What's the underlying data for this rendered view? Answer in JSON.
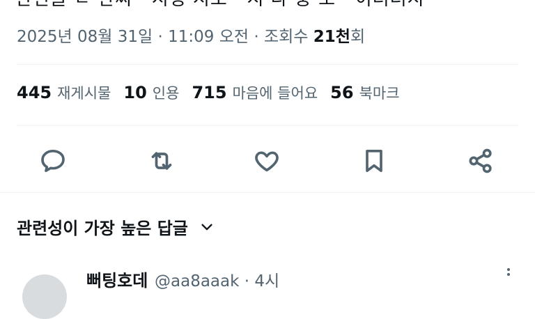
{
  "post": {
    "clipped_text": "관련글 ㄷ 한씨 · 시평 시도 · 시 다 중 도 · 이터터시",
    "date": "2025년 08월 31일",
    "separator": " · ",
    "time": "11:09 오전",
    "views_label": "조회수 ",
    "views_count": "21천",
    "views_suffix": "회"
  },
  "stats": [
    {
      "value": "445",
      "label": "재게시물"
    },
    {
      "value": "10",
      "label": "인용"
    },
    {
      "value": "715",
      "label": "마음에 들어요"
    },
    {
      "value": "56",
      "label": "북마크"
    }
  ],
  "actions": [
    {
      "name": "reply",
      "icon": "reply-icon"
    },
    {
      "name": "repost",
      "icon": "repost-icon"
    },
    {
      "name": "like",
      "icon": "heart-icon"
    },
    {
      "name": "bookmark",
      "icon": "bookmark-icon"
    },
    {
      "name": "share",
      "icon": "share-icon"
    }
  ],
  "sort": {
    "label": "관련성이 가장 높은 답글",
    "icon": "chevron-down-icon"
  },
  "reply_preview": {
    "name": "뻐팅호데",
    "handle": "@aa8aaak · 4시"
  },
  "colors": {
    "text_primary": "#0f1419",
    "text_secondary": "#536471",
    "divider": "#eff3f4"
  }
}
